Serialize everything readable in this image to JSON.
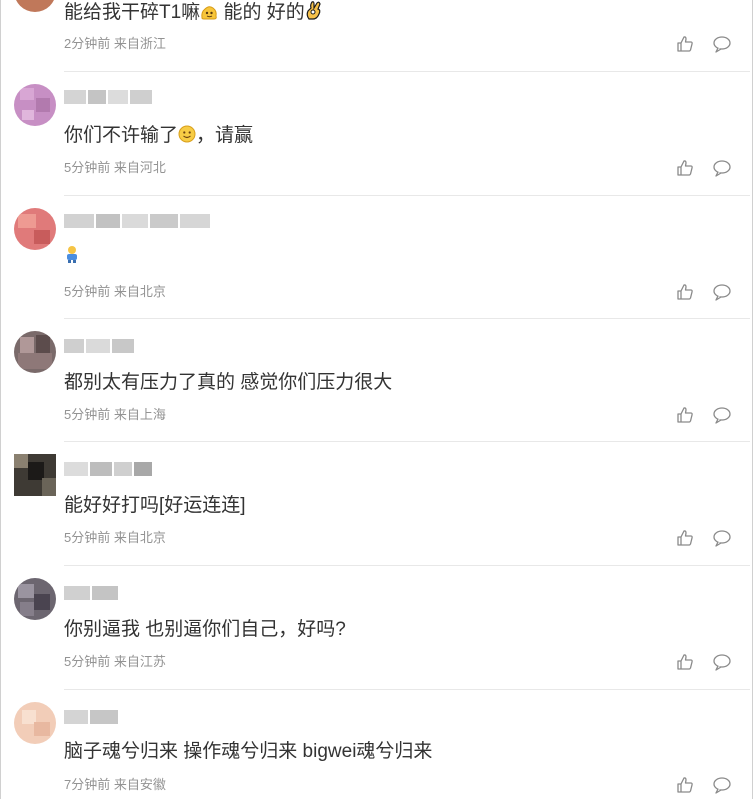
{
  "comments": [
    {
      "text": "能给我干碎T1嘛",
      "text2": " 能的 好的",
      "emoji1": "melting-face",
      "emoji2": "ok-hand",
      "time": "2分钟前",
      "location": "来自浙江",
      "avatar_color": "#c0785a"
    },
    {
      "text": "你们不许输了",
      "text2": "，请赢",
      "emoji1": "slightly-smiling-face",
      "time": "5分钟前",
      "location": "来自河北",
      "avatar_color": "#c78fc4"
    },
    {
      "text": "",
      "emoji1": "person-figure",
      "time": "5分钟前",
      "location": "来自北京",
      "avatar_color": "#e07a7a"
    },
    {
      "text": "都别太有压力了真的 感觉你们压力很大",
      "time": "5分钟前",
      "location": "来自上海",
      "avatar_color": "#7a6a6a"
    },
    {
      "text": "能好好打吗[好运连连]",
      "time": "5分钟前",
      "location": "来自北京",
      "avatar_color": "#3e3a34"
    },
    {
      "text": "你别逼我 也别逼你们自己，好吗?",
      "time": "5分钟前",
      "location": "来自江苏",
      "avatar_color": "#6c6670"
    },
    {
      "text": "脑子魂兮归来 操作魂兮归来 bigwei魂兮归来",
      "time": "7分钟前",
      "location": "来自安徽",
      "avatar_color": "#f2cdb8"
    }
  ],
  "icons": {
    "like": "thumbs-up-icon",
    "reply": "speech-bubble-icon"
  }
}
